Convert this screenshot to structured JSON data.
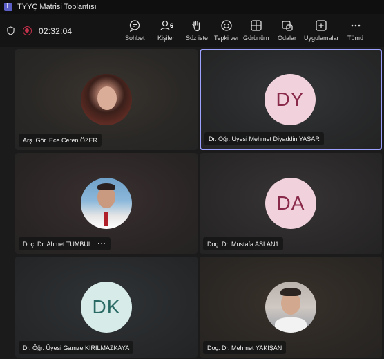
{
  "window": {
    "title": "TYYÇ Matrisi Toplantısı"
  },
  "toolbar": {
    "timer": "02:32:04",
    "buttons": [
      {
        "label": "Sohbet",
        "icon": "chat-icon"
      },
      {
        "label": "Kişiler",
        "icon": "people-icon",
        "badge": "6"
      },
      {
        "label": "Söz iste",
        "icon": "raise-hand-icon"
      },
      {
        "label": "Tepki ver",
        "icon": "emoji-icon"
      },
      {
        "label": "Görünüm",
        "icon": "grid-view-icon"
      },
      {
        "label": "Odalar",
        "icon": "breakout-rooms-icon"
      },
      {
        "label": "Uygulamalar",
        "icon": "add-apps-icon"
      },
      {
        "label": "Tümü",
        "icon": "more-icon"
      }
    ]
  },
  "participants": [
    {
      "name": "Arş. Gör. Ece Ceren ÖZER",
      "avatar": "photo"
    },
    {
      "name": "Dr. Öğr. Üyesi Mehmet Diyaddin YAŞAR",
      "initials": "DY",
      "active_speaker": true
    },
    {
      "name": "Doç. Dr. Ahmet TUMBUL",
      "avatar": "photo",
      "more": "···"
    },
    {
      "name": "Doç. Dr. Mustafa ASLAN1",
      "initials": "DA"
    },
    {
      "name": "Dr. Öğr. Üyesi Gamze KIRILMAZKAYA",
      "initials": "DK"
    },
    {
      "name": "Doç. Dr. Mehmet YAKIŞAN",
      "avatar": "photo"
    }
  ],
  "colors": {
    "active_border": "#9ea2ff",
    "record": "#c4314b",
    "brand": "#5b5fc7"
  }
}
